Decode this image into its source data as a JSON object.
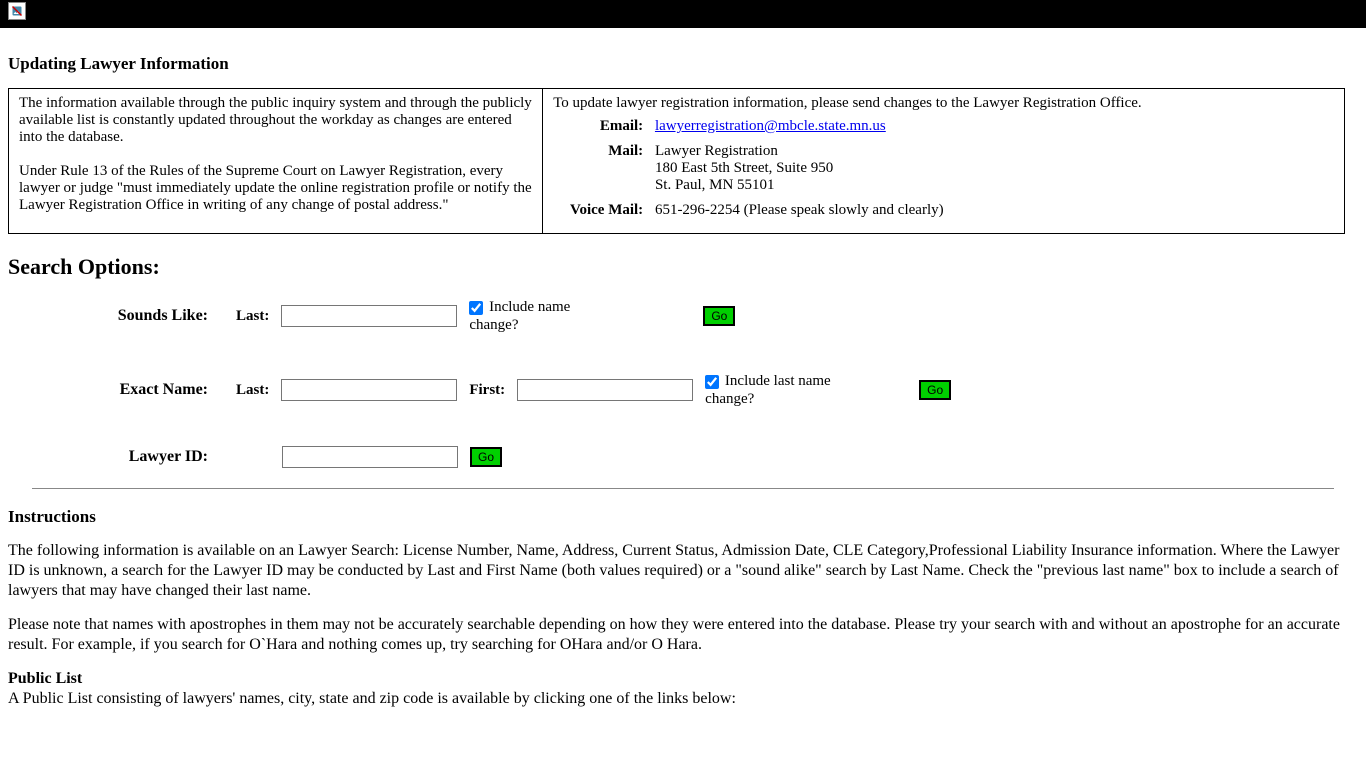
{
  "headings": {
    "updating": "Updating Lawyer Information",
    "search_options": "Search Options:",
    "instructions": "Instructions"
  },
  "info_box": {
    "left_para1": "The information available through the public inquiry system and through the publicly available list is constantly updated throughout the workday as changes are entered into the database.",
    "left_para2": "Under Rule 13 of the Rules of the Supreme Court on Lawyer Registration, every lawyer or judge \"must immediately update the online registration profile or notify the Lawyer Registration Office in writing of any change of postal address.\"",
    "right_intro": "To update lawyer registration information, please send changes to the Lawyer Registration Office.",
    "email_label": "Email:",
    "email_value": "  lawyerregistration@mbcle.state.mn.us",
    "mail_label": "Mail:",
    "mail_line1": "Lawyer Registration",
    "mail_line2": "180 East 5th Street, Suite 950",
    "mail_line3": "St. Paul, MN 55101",
    "voice_label": "Voice Mail:",
    "voice_value": "651-296-2254 (Please speak slowly and clearly)"
  },
  "search": {
    "sounds_like": {
      "title": "Sounds Like:",
      "last_label": "Last:",
      "last_value": "",
      "include_checked": true,
      "include_label": "Include name change?",
      "go": "Go"
    },
    "exact": {
      "title": "Exact Name:",
      "last_label": "Last:",
      "last_value": "",
      "first_label": "First:",
      "first_value": "",
      "include_checked": true,
      "include_label": "Include last name change?",
      "go": "Go"
    },
    "lawyer_id": {
      "title": "Lawyer ID:",
      "value": "",
      "go": "Go"
    }
  },
  "instructions": {
    "p1": "The following information is available on an Lawyer Search: License Number, Name, Address, Current Status, Admission Date, CLE Category,Professional Liability Insurance information. Where the Lawyer ID is unknown, a search for the Lawyer ID may be conducted by Last and First Name (both values required) or a \"sound alike\" search by Last Name. Check the \"previous last name\" box to include a search of lawyers that may have changed their last name.",
    "p2": "Please note that names with apostrophes in them may not be accurately searchable depending on how they were entered into the database. Please try your search with and without an apostrophe for an accurate result. For example, if you search for O`Hara and nothing comes up, try searching for OHara and/or O Hara.",
    "public_list_title": "Public List",
    "public_list_body": "A Public List consisting of lawyers' names, city, state and zip code is available by clicking one of the links below:"
  }
}
